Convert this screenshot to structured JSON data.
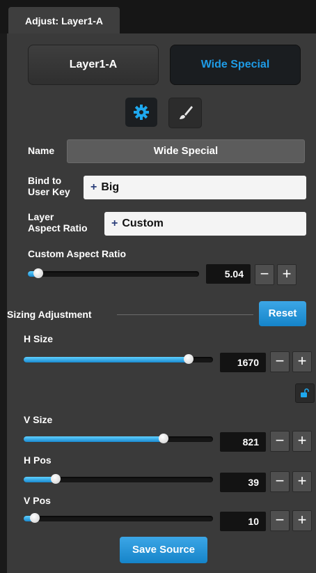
{
  "tab": {
    "title": "Adjust: Layer1-A"
  },
  "layer_buttons": {
    "layer": "Layer1-A",
    "source": "Wide Special"
  },
  "icons": {
    "gear": "gear-icon",
    "brush": "paintbrush-icon",
    "lock": "unlock-icon"
  },
  "form": {
    "name_label": "Name",
    "name_value": "Wide Special",
    "bind_label_1": "Bind to",
    "bind_label_2": "User Key",
    "bind_plus": "+",
    "bind_value": "Big",
    "aspect_label_1": "Layer",
    "aspect_label_2": "Aspect Ratio",
    "aspect_plus": "+",
    "aspect_value": "Custom"
  },
  "custom_aspect": {
    "label": "Custom Aspect Ratio",
    "value": "5.04",
    "level": 0.06
  },
  "sizing": {
    "title": "Sizing Adjustment",
    "reset_label": "Reset",
    "h_size": {
      "label": "H Size",
      "value": "1670",
      "level": 0.87
    },
    "v_size": {
      "label": "V Size",
      "value": "821",
      "level": 0.74
    },
    "h_pos": {
      "label": "H Pos",
      "value": "39",
      "level": 0.17
    },
    "v_pos": {
      "label": "V Pos",
      "value": "10",
      "level": 0.06
    }
  },
  "stepper": {
    "minus": "−",
    "plus": "+"
  },
  "save_label": "Save Source",
  "colors": {
    "accent": "#1e9be6",
    "panel": "#3a3a3a",
    "track": "#161616"
  }
}
